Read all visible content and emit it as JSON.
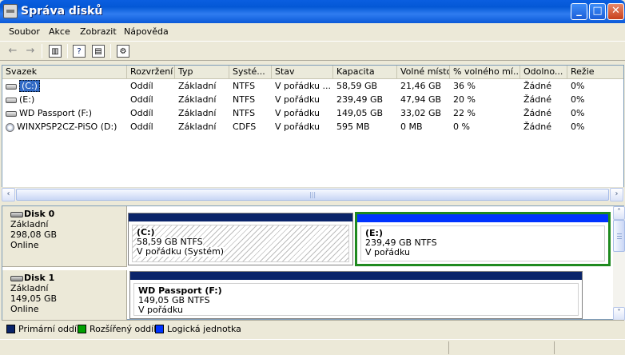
{
  "window": {
    "title": "Správa disků",
    "app_icon": "disk-management-icon",
    "minimize_label": "_",
    "maximize_label": "□",
    "close_label": "✕"
  },
  "menu": [
    "Soubor",
    "Akce",
    "Zobrazit",
    "Nápověda"
  ],
  "toolbar": {
    "back_icon": "←",
    "forward_icon": "→",
    "help_icon": "?"
  },
  "table": {
    "columns": [
      "Svazek",
      "Rozvržení",
      "Typ",
      "Systé...",
      "Stav",
      "Kapacita",
      "Volné místo",
      "% volného mí...",
      "Odolno...",
      "Režie"
    ],
    "rows": [
      {
        "icon": "drive-icon",
        "cells": [
          "(C:)",
          "Oddíl",
          "Základní",
          "NTFS",
          "V pořádku ...",
          "58,59 GB",
          "21,46 GB",
          "36 %",
          "Žádné",
          "0%"
        ]
      },
      {
        "icon": "drive-icon",
        "cells": [
          "(E:)",
          "Oddíl",
          "Základní",
          "NTFS",
          "V pořádku",
          "239,49 GB",
          "47,94 GB",
          "20 %",
          "Žádné",
          "0%"
        ]
      },
      {
        "icon": "drive-icon",
        "cells": [
          "WD Passport (F:)",
          "Oddíl",
          "Základní",
          "NTFS",
          "V pořádku",
          "149,05 GB",
          "33,02 GB",
          "22 %",
          "Žádné",
          "0%"
        ]
      },
      {
        "icon": "cd-icon",
        "cells": [
          "WINXPSP2CZ-PiSO (D:)",
          "Oddíl",
          "Základní",
          "CDFS",
          "V pořádku",
          "595 MB",
          "0 MB",
          "0 %",
          "Žádné",
          "0%"
        ]
      }
    ]
  },
  "scroll": {
    "left": "‹",
    "right": "›",
    "grip": "|||",
    "up": "˄",
    "down": "˅"
  },
  "disks": [
    {
      "name": "Disk 0",
      "type": "Základní",
      "size": "298,08 GB",
      "status": "Online",
      "partitions": [
        {
          "name": "(C:)",
          "size": "58,59 GB NTFS",
          "status": "V pořádku (Systém)",
          "kind": "primary"
        },
        {
          "name": "(E:)",
          "size": "239,49 GB NTFS",
          "status": "V pořádku",
          "kind": "logical"
        }
      ]
    },
    {
      "name": "Disk 1",
      "type": "Základní",
      "size": "149,05 GB",
      "status": "Online",
      "partitions": [
        {
          "name": "WD Passport  (F:)",
          "size": "149,05 GB NTFS",
          "status": "V pořádku",
          "kind": "primary"
        }
      ]
    }
  ],
  "legend": [
    {
      "label": "Primární oddíl",
      "color": "#0a246a"
    },
    {
      "label": "Rozšířený oddíl",
      "color": "#00a000"
    },
    {
      "label": "Logická jednotka",
      "color": "#0033ff"
    }
  ],
  "colors": {
    "selection_border": "#1f8a1f",
    "primary": "#0a246a",
    "logical": "#0033ff"
  }
}
